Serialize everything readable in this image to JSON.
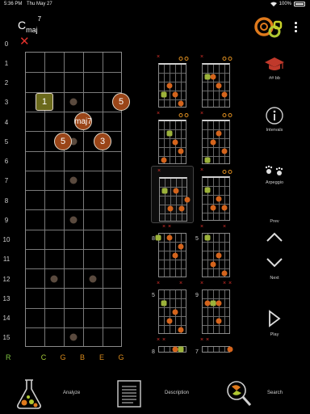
{
  "status": {
    "time": "5:36 PM",
    "date": "Thu May 27",
    "battery": "100%"
  },
  "chord": {
    "root": "C",
    "quality": "maj",
    "extension": "7"
  },
  "fretboard": {
    "fret_numbers": [
      "0",
      "1",
      "2",
      "3",
      "4",
      "5",
      "6",
      "7",
      "8",
      "9",
      "10",
      "11",
      "12",
      "13",
      "14",
      "15"
    ],
    "string_labels": [
      "C",
      "G",
      "B",
      "E",
      "G"
    ],
    "root_label": "R",
    "notes": [
      {
        "label": "1",
        "fret": 3,
        "string": 1,
        "root": true
      },
      {
        "label": "5",
        "fret": 3,
        "string": 6,
        "root": false
      },
      {
        "label": "maj7",
        "fret": 4,
        "string": 4,
        "root": false
      },
      {
        "label": "5",
        "fret": 5,
        "string": 3,
        "root": false
      },
      {
        "label": "3",
        "fret": 5,
        "string": 5,
        "root": false
      }
    ]
  },
  "voicings": [
    {
      "fret_label": ""
    },
    {
      "fret_label": ""
    },
    {
      "fret_label": ""
    },
    {
      "fret_label": ""
    },
    {
      "fret_label": ""
    },
    {
      "fret_label": ""
    },
    {
      "fret_label": "8"
    },
    {
      "fret_label": "5"
    },
    {
      "fret_label": "5"
    },
    {
      "fret_label": "9"
    },
    {
      "fret_label": "8"
    },
    {
      "fret_label": "7"
    }
  ],
  "sidebar": {
    "notation_label": "##  bb",
    "intervals_label": "Intervals",
    "arpeggio_label": "Arpeggio",
    "prev_label": "Prev",
    "next_label": "Next",
    "play_label": "Play"
  },
  "bottom": {
    "analyze_label": "Analyze",
    "description_label": "Description",
    "search_label": "Search"
  },
  "colors": {
    "note": "#9a4518",
    "root": "#6b6a1c",
    "accent": "#d4641c",
    "mute": "#e0312b"
  }
}
